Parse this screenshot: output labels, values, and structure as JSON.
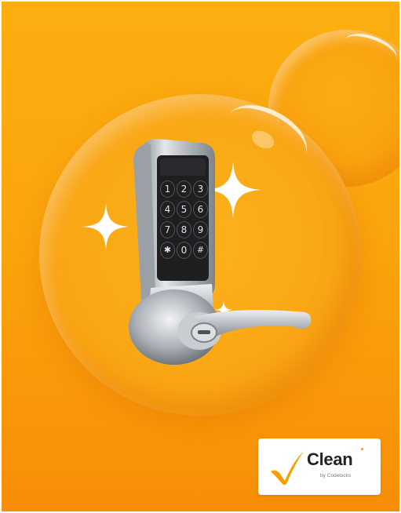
{
  "image": {
    "subject": "smart lock with keypad",
    "colors": {
      "background_top": "#fcae0f",
      "background_bottom": "#f78e06",
      "badge_check": "#f5a000",
      "lock_metal": "#c8ccd1",
      "keypad": "#1f1f22"
    }
  },
  "keypad": {
    "keys": [
      "1",
      "2",
      "3",
      "4",
      "5",
      "6",
      "7",
      "8",
      "9",
      "✱",
      "0",
      "#"
    ]
  },
  "badge": {
    "icon": "checkmark-icon",
    "word": "Clean",
    "subtitle": "by Codelocks"
  }
}
